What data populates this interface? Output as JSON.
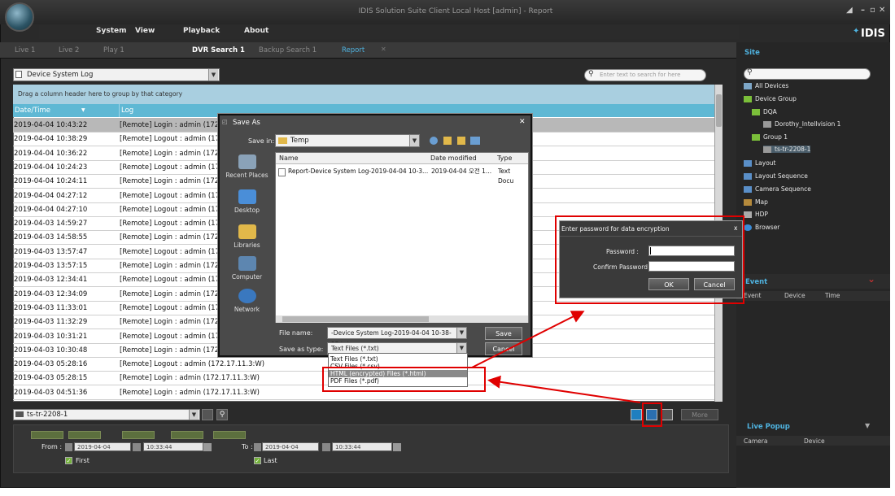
{
  "window": {
    "title": "IDIS Solution Suite Client Local Host [admin] - Report",
    "brand": "IDIS"
  },
  "menu": [
    "System",
    "View",
    "Playback",
    "About"
  ],
  "tabs": [
    {
      "label": "Live 1"
    },
    {
      "label": "Live 2"
    },
    {
      "label": "Play 1"
    },
    {
      "label": "DVR Search 1"
    },
    {
      "label": "Backup Search 1"
    },
    {
      "label": "Report"
    }
  ],
  "report": {
    "type_select": "Device System Log",
    "search_placeholder": "Enter text to search for here",
    "group_hint": "Drag a column header here to group by that category",
    "columns": {
      "datetime": "Date/Time",
      "log": "Log"
    },
    "rows": [
      {
        "dt": "2019-04-04  10:43:22",
        "log": "[Remote] Login : admin (172.1"
      },
      {
        "dt": "2019-04-04  10:38:29",
        "log": "[Remote] Logout : admin (172."
      },
      {
        "dt": "2019-04-04  10:36:22",
        "log": "[Remote] Login : admin (172.1"
      },
      {
        "dt": "2019-04-04  10:24:23",
        "log": "[Remote] Logout : admin (172"
      },
      {
        "dt": "2019-04-04  10:24:11",
        "log": "[Remote] Login : admin (172.1"
      },
      {
        "dt": "2019-04-04  04:27:12",
        "log": "[Remote] Logout : admin (172."
      },
      {
        "dt": "2019-04-04  04:27:10",
        "log": "[Remote] Logout : admin (172"
      },
      {
        "dt": "2019-04-03  14:59:27",
        "log": "[Remote] Logout : admin (172"
      },
      {
        "dt": "2019-04-03  14:58:55",
        "log": "[Remote] Login : admin (172.1"
      },
      {
        "dt": "2019-04-03  13:57:47",
        "log": "[Remote] Logout : admin (172"
      },
      {
        "dt": "2019-04-03  13:57:15",
        "log": "[Remote] Login : admin (172.1"
      },
      {
        "dt": "2019-04-03  12:34:41",
        "log": "[Remote] Logout : admin (172"
      },
      {
        "dt": "2019-04-03  12:34:09",
        "log": "[Remote] Login : admin (172.1"
      },
      {
        "dt": "2019-04-03  11:33:01",
        "log": "[Remote] Logout : admin (172"
      },
      {
        "dt": "2019-04-03  11:32:29",
        "log": "[Remote] Login : admin (172.1"
      },
      {
        "dt": "2019-04-03  10:31:21",
        "log": "[Remote] Logout : admin (172"
      },
      {
        "dt": "2019-04-03  10:30:48",
        "log": "[Remote] Login : admin (172.1"
      },
      {
        "dt": "2019-04-03  05:28:16",
        "log": "[Remote] Logout : admin (172.17.11.3:W)"
      },
      {
        "dt": "2019-04-03  05:28:15",
        "log": "[Remote] Login : admin (172.17.11.3:W)"
      },
      {
        "dt": "2019-04-03  04:51:36",
        "log": "[Remote] Login : admin (172.17.11.3:W)"
      }
    ],
    "device_select": "ts-tr-2208-1",
    "more_label": "More",
    "from_label": "From :",
    "to_label": "To :",
    "from_date": "2019-04-04",
    "from_time": "10:33:44",
    "to_date": "2019-04-04",
    "to_time": "10:33:44",
    "first_label": "First",
    "last_label": "Last"
  },
  "save_as": {
    "title": "Save As",
    "save_in_label": "Save in:",
    "save_in_value": "Temp",
    "places": [
      "Recent Places",
      "Desktop",
      "Libraries",
      "Computer",
      "Network"
    ],
    "columns": {
      "name": "Name",
      "modified": "Date modified",
      "type": "Type"
    },
    "file": {
      "name": "Report-Device System Log-2019-04-04 10-3...",
      "modified": "2019-04-04 오전 1...",
      "type": "Text Docu"
    },
    "file_name_label": "File name:",
    "file_name_value": "-Device System Log-2019-04-04 10-38-12.txt",
    "save_type_label": "Save as type:",
    "save_type_value": "Text Files (*.txt)",
    "save_button": "Save",
    "cancel_button": "Cancel",
    "type_options": [
      "Text Files (*.txt)",
      "CSV Files (*.csv)",
      "HTML (encrypted) Files (*.html)",
      "PDF Files (*.pdf)"
    ]
  },
  "password_dialog": {
    "title": "Enter password for data encryption",
    "password_label": "Password :",
    "confirm_label": "Confirm Password :",
    "ok": "OK",
    "cancel": "Cancel",
    "close": "x"
  },
  "site": {
    "title": "Site",
    "tree": [
      "All Devices",
      "Device Group",
      "DQA",
      "Dorothy_Intellvision 1",
      "Group 1",
      "ts-tr-2208-1",
      "Layout",
      "Layout Sequence",
      "Camera Sequence",
      "Map",
      "HDP",
      "Browser"
    ]
  },
  "event": {
    "title": "Event",
    "cols": [
      "Event",
      "Device",
      "Time"
    ]
  },
  "live_popup": {
    "title": "Live Popup",
    "cols": [
      "Camera",
      "Device"
    ]
  }
}
